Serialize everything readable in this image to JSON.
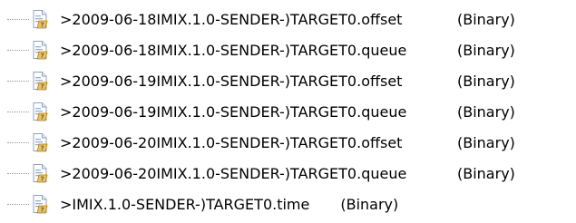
{
  "tree": {
    "items": [
      {
        "name": ">2009-06-18IMIX.1.0-SENDER-)TARGET0.offset",
        "type": "(Binary)"
      },
      {
        "name": ">2009-06-18IMIX.1.0-SENDER-)TARGET0.queue",
        "type": "(Binary)"
      },
      {
        "name": ">2009-06-19IMIX.1.0-SENDER-)TARGET0.offset",
        "type": "(Binary)"
      },
      {
        "name": ">2009-06-19IMIX.1.0-SENDER-)TARGET0.queue",
        "type": "(Binary)"
      },
      {
        "name": ">2009-06-20IMIX.1.0-SENDER-)TARGET0.offset",
        "type": "(Binary)"
      },
      {
        "name": ">2009-06-20IMIX.1.0-SENDER-)TARGET0.queue",
        "type": "(Binary)"
      },
      {
        "name": ">IMIX.1.0-SENDER-)TARGET0.time",
        "type": "(Binary)"
      }
    ]
  },
  "colors": {
    "connector": "#9a9a9a",
    "icon_page": "#ffffff",
    "icon_border": "#8fa2bf",
    "icon_badge": "#f2c14e",
    "icon_badge_border": "#b57d0b"
  }
}
